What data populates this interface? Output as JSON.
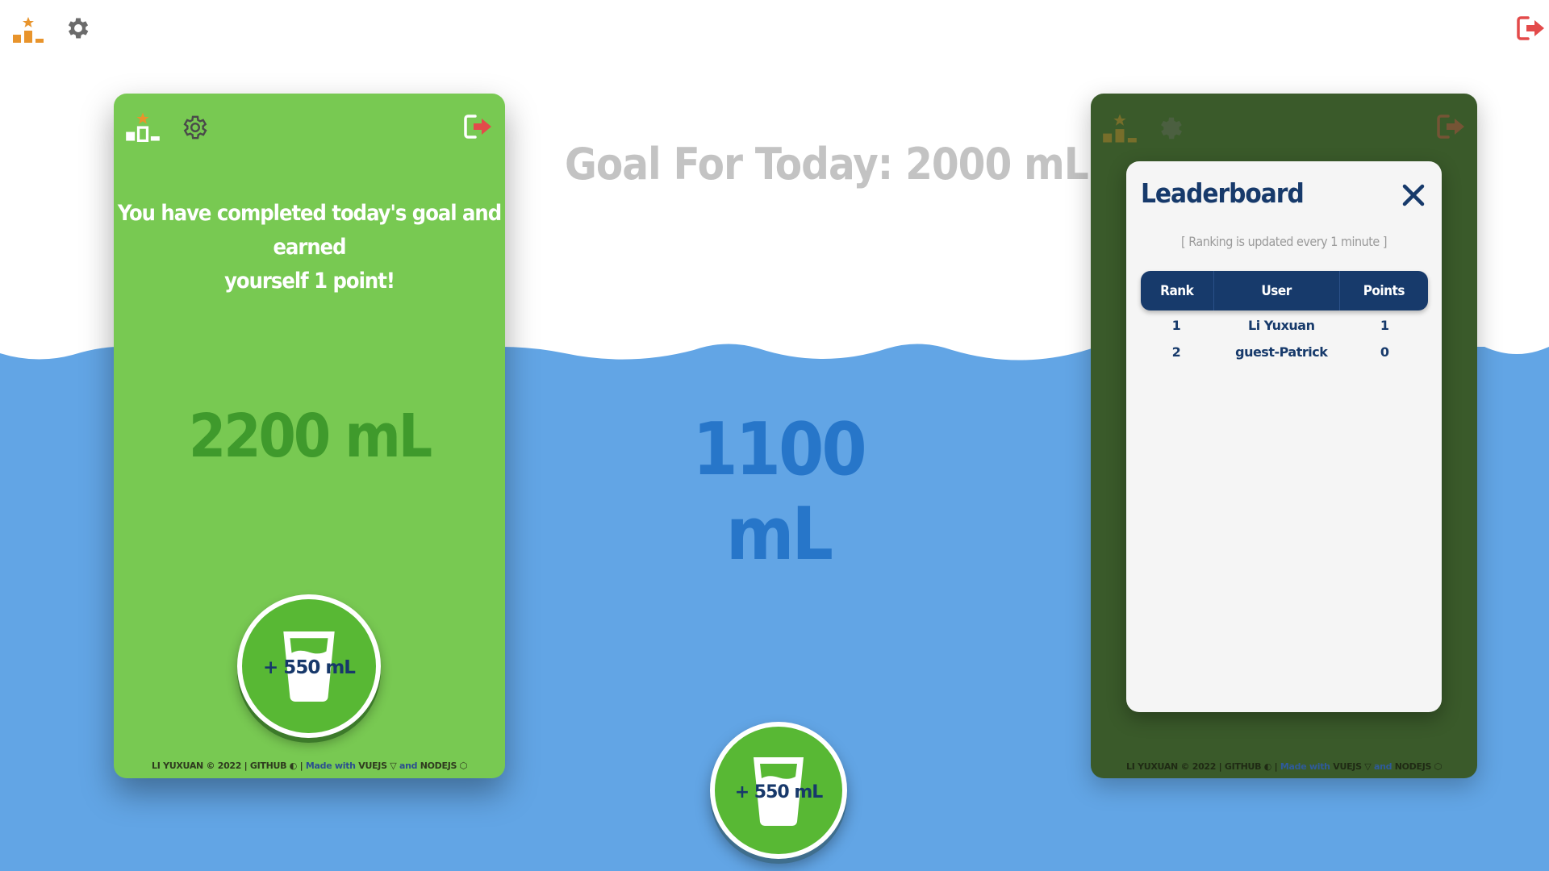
{
  "top_bar": {
    "icons": [
      "leaderboard-icon",
      "gear-icon",
      "logout-icon"
    ]
  },
  "goal": {
    "text": "Goal For Today: 2000 mL"
  },
  "main": {
    "amount": "1100 mL",
    "cup_button_label": "+ 550 mL"
  },
  "left_card": {
    "message_line1": "You have completed today's goal and earned",
    "message_line2": "yourself 1 point!",
    "amount": "2200 mL",
    "cup_button_label": "+ 550 mL",
    "footer": {
      "prefix": "LI YUXUAN © 2022 | GITHUB ◐ | ",
      "made_with": "Made with",
      "vuejs": " VUEJS ▽ ",
      "and": "and",
      "nodejs": " NODEJS ⬡"
    }
  },
  "right_card": {
    "footer": {
      "prefix": "LI YUXUAN © 2022 | GITHUB ◐ | ",
      "made_with": "Made with",
      "vuejs": " VUEJS ▽ ",
      "and": "and",
      "nodejs": " NODEJS ⬡"
    }
  },
  "leaderboard": {
    "title": "Leaderboard",
    "note": "[ Ranking is updated every 1 minute ]",
    "columns": {
      "rank": "Rank",
      "user": "User",
      "points": "Points"
    },
    "rows": [
      {
        "rank": "1",
        "user": "Li Yuxuan",
        "points": "1"
      },
      {
        "rank": "2",
        "user": "guest-Patrick",
        "points": "0"
      }
    ]
  },
  "colors": {
    "water": "#62a5e5",
    "card_green": "#78c952",
    "card_dim": "#3a5a2a",
    "button_green": "#58b834",
    "navy": "#173a6b",
    "accent_orange": "#e8942c",
    "logout_red": "#e34a4a",
    "gear_gray": "#6b6b6b"
  }
}
